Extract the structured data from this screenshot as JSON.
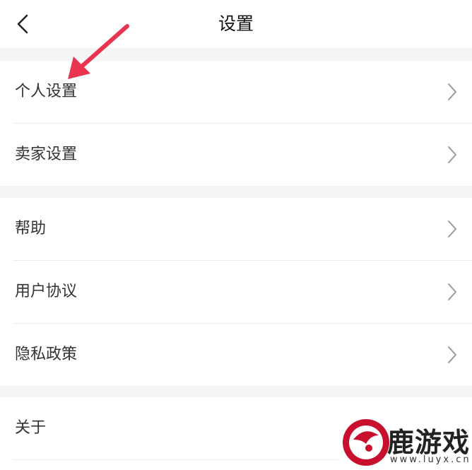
{
  "header": {
    "title": "设置"
  },
  "groups": [
    {
      "items": [
        {
          "label": "个人设置"
        },
        {
          "label": "卖家设置"
        }
      ]
    },
    {
      "items": [
        {
          "label": "帮助"
        },
        {
          "label": "用户协议"
        },
        {
          "label": "隐私政策"
        }
      ]
    },
    {
      "items": [
        {
          "label": "关于"
        }
      ]
    }
  ],
  "watermark": {
    "text": "鹿游戏",
    "url": "www.luyx.cn"
  },
  "colors": {
    "annotation_arrow": "#e8344e",
    "background": "#f5f5f5",
    "chevron": "#9a9a9a"
  }
}
